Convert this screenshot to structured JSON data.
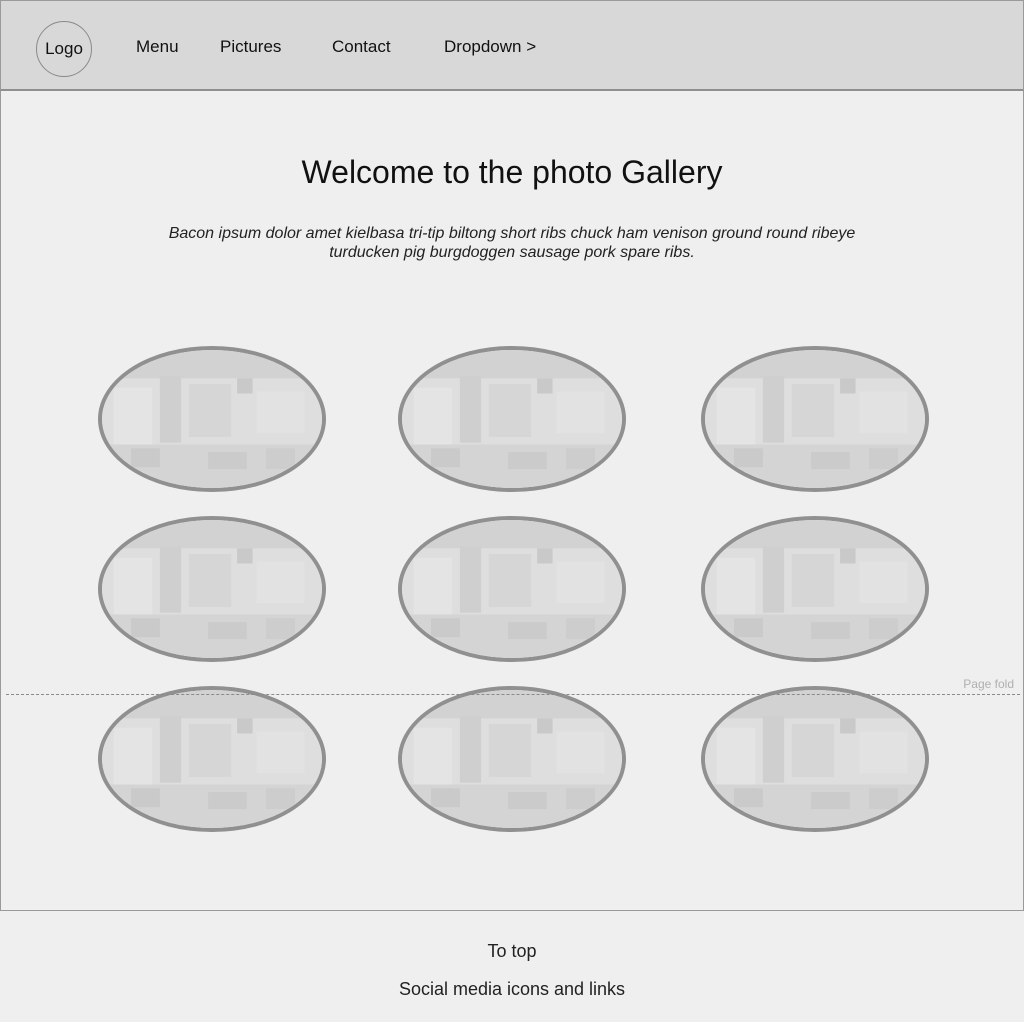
{
  "header": {
    "logo_label": "Logo",
    "nav": [
      {
        "label": "Menu"
      },
      {
        "label": "Pictures"
      },
      {
        "label": "Contact"
      },
      {
        "label": "Dropdown >"
      }
    ]
  },
  "main": {
    "title": "Welcome to the photo Gallery",
    "intro": "Bacon ipsum dolor amet kielbasa tri-tip biltong short ribs chuck ham venison ground round ribeye turducken pig burgdoggen sausage pork spare ribs.",
    "fold_label": "Page fold"
  },
  "footer": {
    "to_top": "To top",
    "social": "Social media icons and links"
  },
  "colors": {
    "header_bg": "#d8d8d8",
    "page_bg": "#efefef",
    "photo_border": "#909090"
  }
}
